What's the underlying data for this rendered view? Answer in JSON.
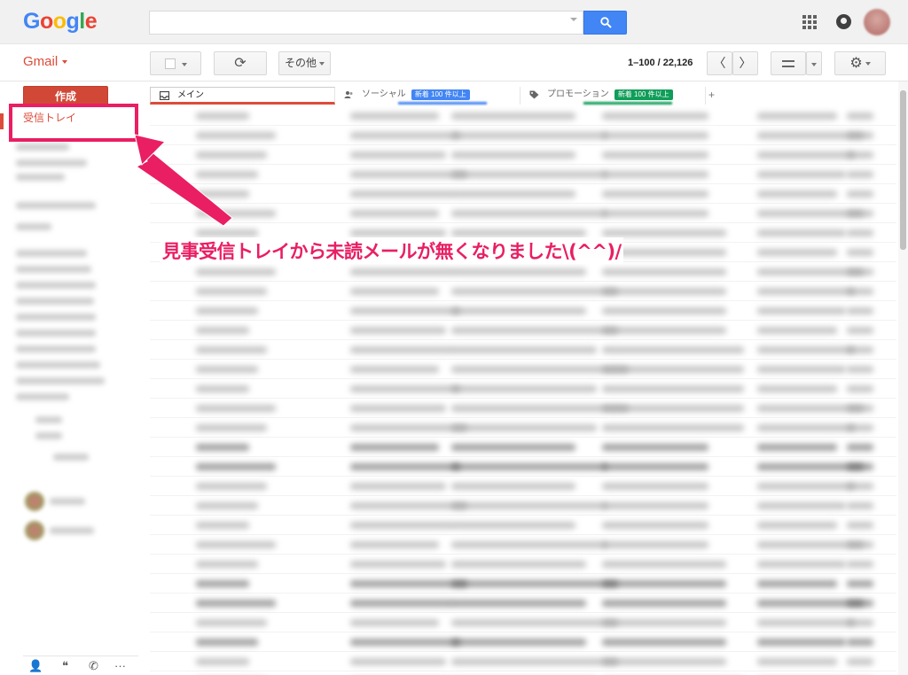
{
  "header": {
    "logo_letters": [
      {
        "char": "G",
        "color": "#4285f4"
      },
      {
        "char": "o",
        "color": "#ea4335"
      },
      {
        "char": "o",
        "color": "#fbbc05"
      },
      {
        "char": "g",
        "color": "#4285f4"
      },
      {
        "char": "l",
        "color": "#34a853"
      },
      {
        "char": "e",
        "color": "#ea4335"
      }
    ],
    "search": {
      "value": "",
      "placeholder": ""
    },
    "icons": [
      "search-icon",
      "apps-icon",
      "notifications-icon",
      "avatar"
    ]
  },
  "toolbar": {
    "gmail_label": "Gmail",
    "more_label": "その他",
    "refresh_glyph": "⟳",
    "settings_glyph": "⚙",
    "page_count": "1–100 / 22,126",
    "prev_glyph": "〈",
    "next_glyph": "〉"
  },
  "sidebar": {
    "compose_label": "作成",
    "inbox_label": "受信トレイ"
  },
  "tabs": {
    "primary_label": "メイン",
    "social_label": "ソーシャル",
    "social_badge": "新着 100 件以上",
    "promo_label": "プロモーション",
    "promo_badge": "新着 100 件以上",
    "add_glyph": "+"
  },
  "bottom_bar": {
    "person_glyph": "👤",
    "hangouts_glyph": "❝",
    "phone_glyph": "✆",
    "more_glyph": "···"
  },
  "annotation": {
    "text": "見事受信トレイから未読メールが無くなりました\\(^^)/",
    "color": "#e91e63"
  }
}
